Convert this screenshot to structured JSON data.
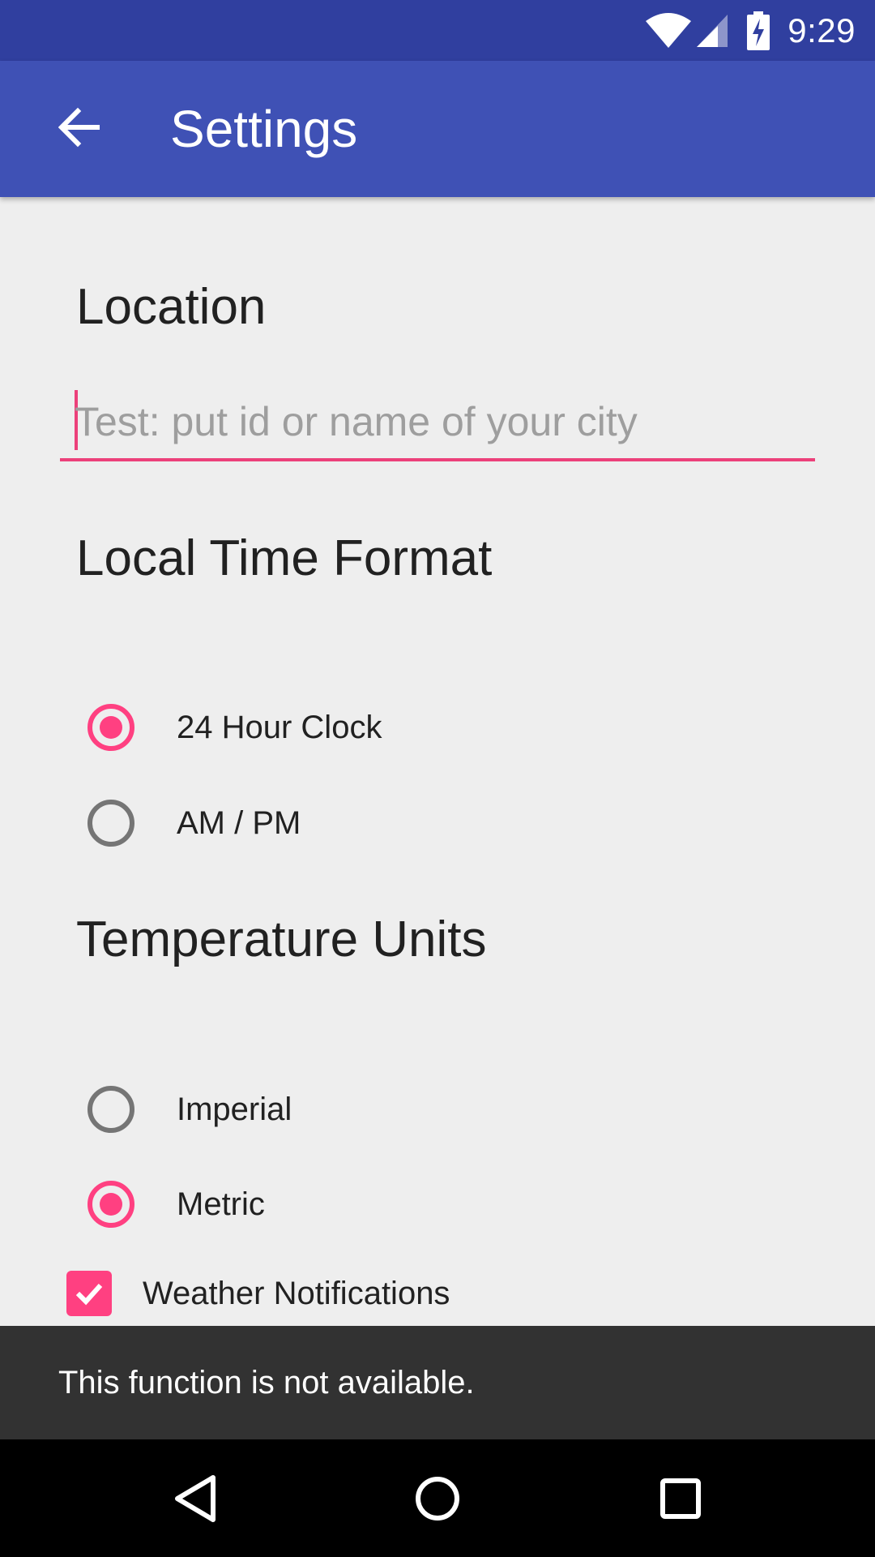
{
  "status_bar": {
    "time": "9:29",
    "icons": [
      "wifi-icon",
      "cell-signal-icon",
      "battery-charging-icon"
    ],
    "background": "#303f9f"
  },
  "app_bar": {
    "title": "Settings",
    "back_icon": "arrow-back-icon",
    "background": "#3f51b5"
  },
  "location": {
    "title": "Location",
    "input_value": "",
    "placeholder": "Test: put id or name of your city"
  },
  "time_format": {
    "title": "Local Time Format",
    "options": [
      {
        "label": "24 Hour Clock",
        "selected": true
      },
      {
        "label": "AM / PM",
        "selected": false
      }
    ]
  },
  "temperature_units": {
    "title": "Temperature Units",
    "options": [
      {
        "label": "Imperial",
        "selected": false
      },
      {
        "label": "Metric",
        "selected": true
      }
    ]
  },
  "notifications": {
    "label": "Weather Notifications",
    "checked": true
  },
  "snackbar": {
    "message": "This function is not available."
  },
  "nav_bar": {
    "buttons": [
      "back-triangle-icon",
      "home-circle-icon",
      "recents-square-icon"
    ]
  },
  "colors": {
    "accent": "#ff4081",
    "primary": "#3f51b5",
    "primary_dark": "#303f9f",
    "background": "#eeeeee"
  }
}
